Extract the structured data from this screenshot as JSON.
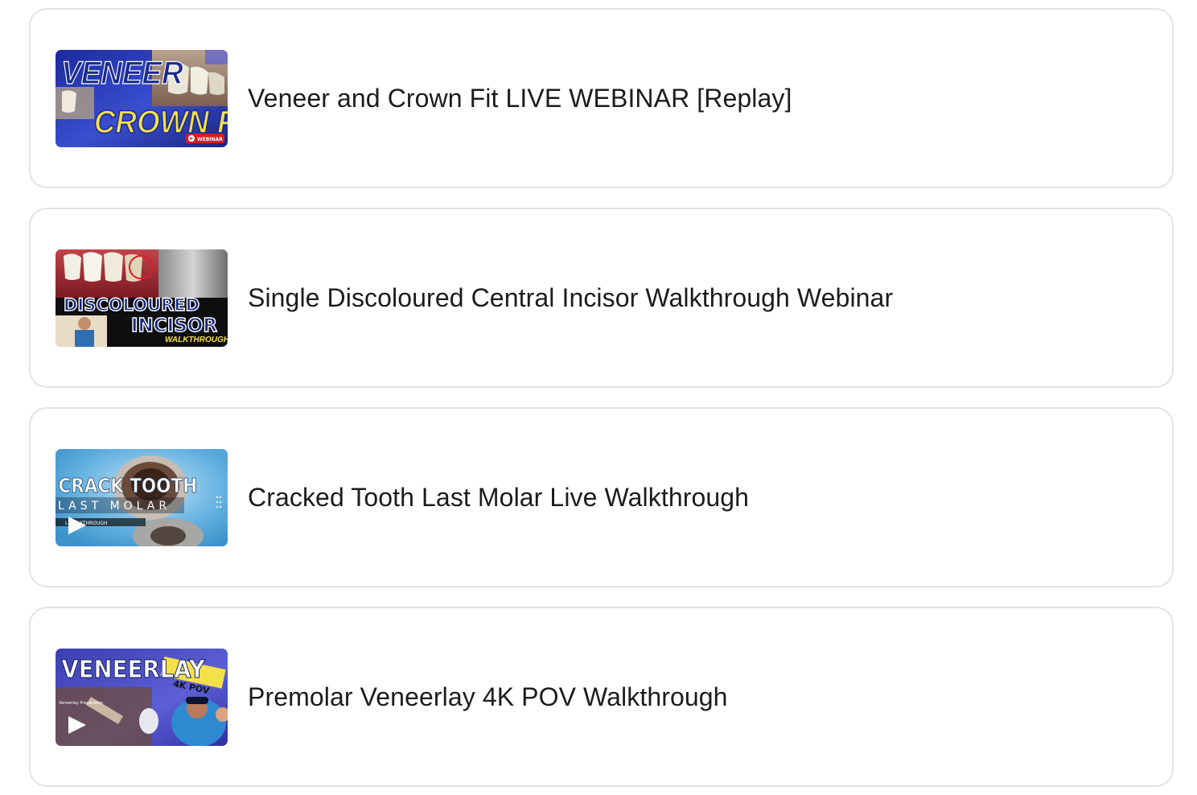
{
  "lessons": [
    {
      "title": "Veneer and Crown Fit LIVE WEBINAR [Replay]",
      "thumb": {
        "line1": "VENEER",
        "line2": "CROWN FIT",
        "badge": "WEBINAR",
        "icon": "play-badge-icon"
      }
    },
    {
      "title": "Single Discoloured Central Incisor Walkthrough Webinar",
      "thumb": {
        "line1": "DISCOLOURED",
        "line2": "INCISOR",
        "line3": "WALKTHROUGH"
      }
    },
    {
      "title": "Cracked Tooth Last Molar Live Walkthrough",
      "thumb": {
        "line1": "CRACK TOOTH",
        "line2": "LAST MOLAR",
        "line3": "L   WALKTHROUGH",
        "icon": "play-icon"
      }
    },
    {
      "title": "Premolar Veneerlay 4K POV Walkthrough",
      "thumb": {
        "line1": "VENEERLAY",
        "line2": "4K POV",
        "line3": "Veneerlay Preparation",
        "icon": "play-icon"
      }
    }
  ],
  "colors": {
    "card_border": "#e3e3e6",
    "title_text": "#1c1c1e",
    "veneer_yellow": "#f4e04a",
    "discoloured_blue": "#13267a"
  }
}
